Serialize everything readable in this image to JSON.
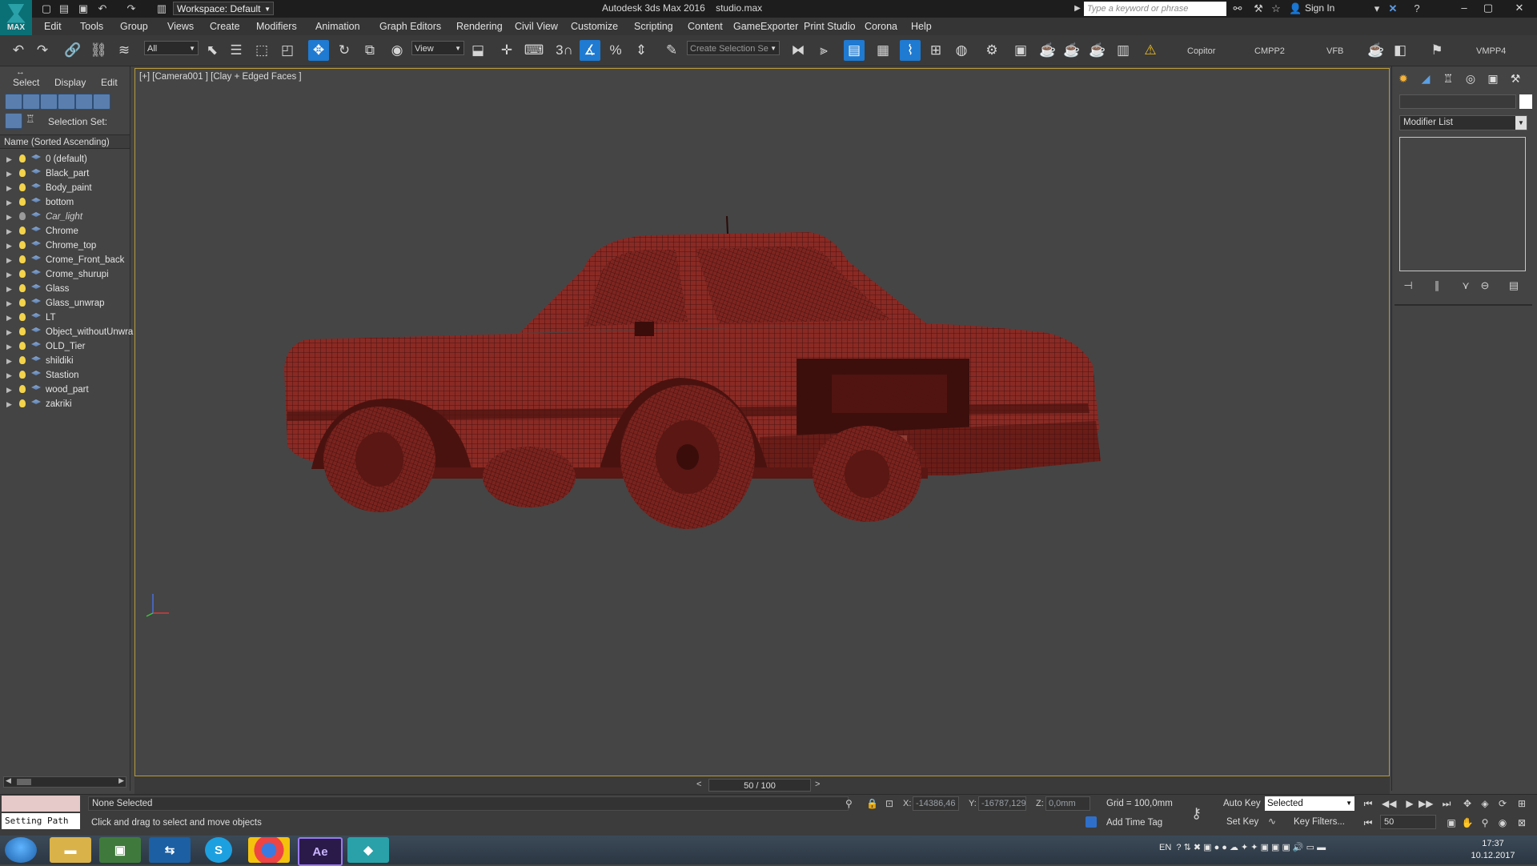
{
  "title_bar": {
    "app_label": "MAX",
    "workspace": "Workspace: Default",
    "app_title": "Autodesk 3ds Max 2016",
    "file_name": "studio.max",
    "search_placeholder": "Type a keyword or phrase",
    "sign_in": "Sign In"
  },
  "menu": [
    "Edit",
    "Tools",
    "Group",
    "Views",
    "Create",
    "Modifiers",
    "Animation",
    "Graph Editors",
    "Rendering",
    "Civil View",
    "Customize",
    "Scripting",
    "Content",
    "GameExporter",
    "Print Studio",
    "Corona",
    "Help"
  ],
  "toolbar": {
    "filter_value": "All",
    "ref_coord_value": "View",
    "snap_label": "3",
    "selection_set_placeholder": "Create Selection Se",
    "plugin_labels": [
      "Copitor",
      "CMPP2",
      "VFB",
      "VMPP4"
    ]
  },
  "scene_explorer": {
    "tabs": [
      "Select",
      "Display",
      "Edit"
    ],
    "selection_set_label": "Selection Set:",
    "column_header": "Name (Sorted Ascending)",
    "layers": [
      {
        "name": "0 (default)",
        "light_on": true,
        "italic": false
      },
      {
        "name": "Black_part",
        "light_on": true,
        "italic": false
      },
      {
        "name": "Body_paint",
        "light_on": true,
        "italic": false
      },
      {
        "name": "bottom",
        "light_on": true,
        "italic": false
      },
      {
        "name": "Car_light",
        "light_on": false,
        "italic": true
      },
      {
        "name": "Chrome",
        "light_on": true,
        "italic": false
      },
      {
        "name": "Chrome_top",
        "light_on": true,
        "italic": false
      },
      {
        "name": "Crome_Front_back",
        "light_on": true,
        "italic": false
      },
      {
        "name": "Crome_shurupi",
        "light_on": true,
        "italic": false
      },
      {
        "name": "Glass",
        "light_on": true,
        "italic": false
      },
      {
        "name": "Glass_unwrap",
        "light_on": true,
        "italic": false
      },
      {
        "name": "LT",
        "light_on": true,
        "italic": false
      },
      {
        "name": "Object_withoutUnwra",
        "light_on": true,
        "italic": false
      },
      {
        "name": "OLD_Tier",
        "light_on": true,
        "italic": false
      },
      {
        "name": "shildiki",
        "light_on": true,
        "italic": false
      },
      {
        "name": "Stastion",
        "light_on": true,
        "italic": false
      },
      {
        "name": "wood_part",
        "light_on": true,
        "italic": false
      },
      {
        "name": "zakriki",
        "light_on": true,
        "italic": false
      }
    ]
  },
  "viewport": {
    "label": "[+] [Camera001 ] [Clay + Edged Faces ]",
    "model_color": "#8a2a24",
    "wire_color": "#3a0d0b",
    "axis_x_color": "#d43c3c",
    "axis_y_color": "#3cc83c",
    "axis_z_color": "#4a6ee0"
  },
  "command_panel": {
    "modifier_list": "Modifier List"
  },
  "time_slider": {
    "frame_display": "50 / 100"
  },
  "status": {
    "setting_path": "Setting Path",
    "selection_status": "None Selected",
    "prompt": "Click and drag to select and move objects",
    "x_label": "X:",
    "x_value": "-14386,46",
    "y_label": "Y:",
    "y_value": "-16787,129",
    "z_label": "Z:",
    "z_value": "0,0mm",
    "grid": "Grid = 100,0mm",
    "add_time_tag": "Add Time Tag",
    "auto_key": "Auto Key",
    "set_key": "Set Key",
    "key_mode_value": "Selected",
    "key_filters": "Key Filters...",
    "current_frame": "50"
  },
  "taskbar": {
    "ae_label": "Ae",
    "skype_label": "S",
    "language": "EN",
    "time": "17:37",
    "date": "10.12.2017"
  }
}
